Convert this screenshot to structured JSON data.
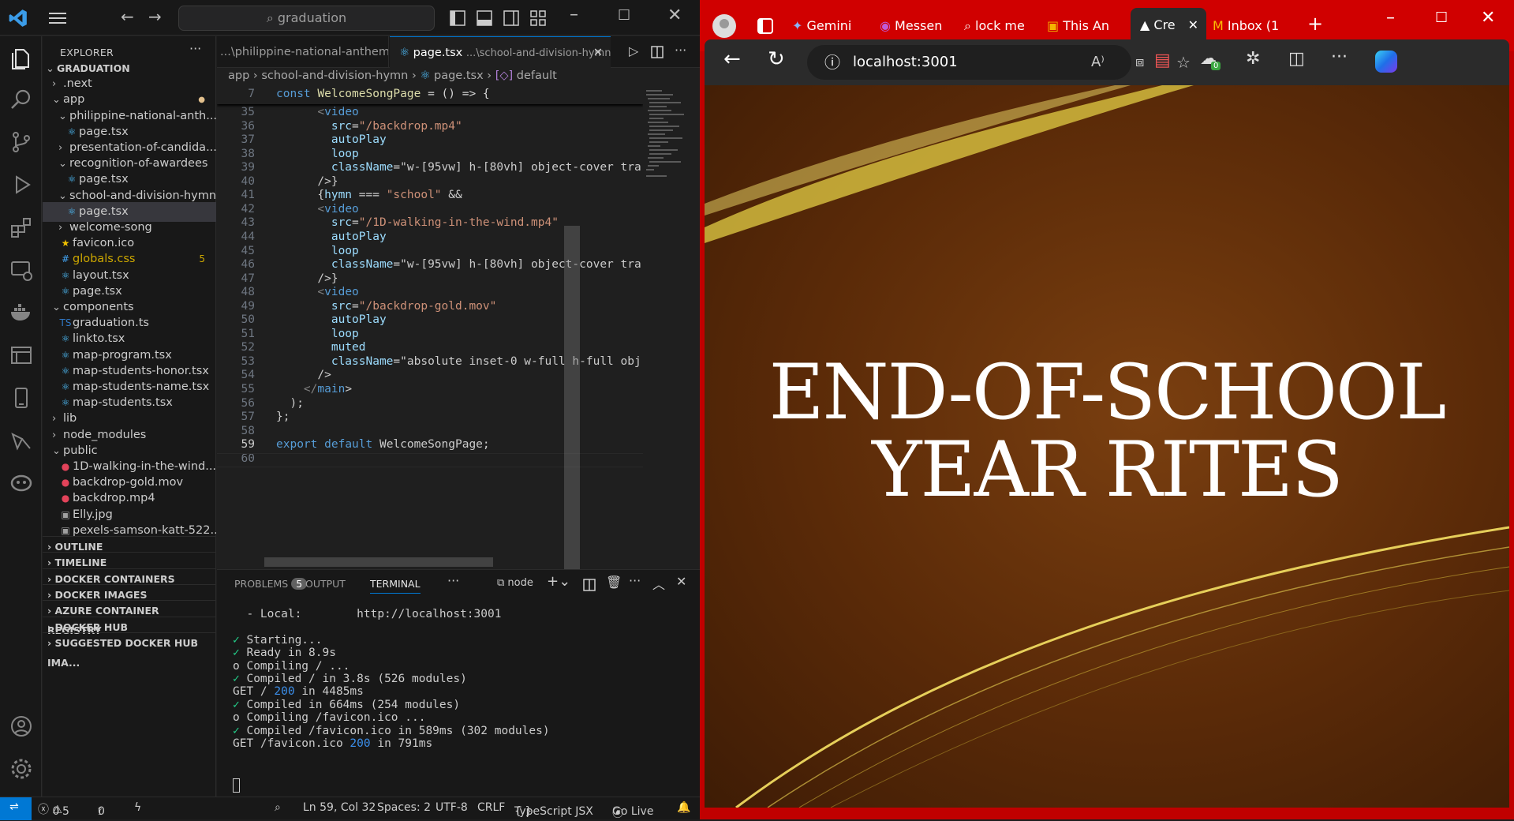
{
  "vscode": {
    "command_center": "graduation",
    "explorer_title": "EXPLORER",
    "tree": [
      {
        "label": "GRADUATION",
        "depth": 0,
        "type": "root"
      },
      {
        "label": ".next",
        "depth": 1,
        "type": "folder-closed"
      },
      {
        "label": "app",
        "depth": 1,
        "type": "folder-open",
        "accent": "#e2c08d"
      },
      {
        "label": "philippine-national-anth...",
        "depth": 2,
        "type": "folder-open"
      },
      {
        "label": "page.tsx",
        "depth": 3,
        "type": "react"
      },
      {
        "label": "presentation-of-candida...",
        "depth": 2,
        "type": "folder-closed"
      },
      {
        "label": "recognition-of-awardees",
        "depth": 2,
        "type": "folder-open"
      },
      {
        "label": "page.tsx",
        "depth": 3,
        "type": "react"
      },
      {
        "label": "school-and-division-hymn",
        "depth": 2,
        "type": "folder-open"
      },
      {
        "label": "page.tsx",
        "depth": 3,
        "type": "react",
        "selected": true
      },
      {
        "label": "welcome-song",
        "depth": 2,
        "type": "folder-closed"
      },
      {
        "label": "favicon.ico",
        "depth": 2,
        "type": "star"
      },
      {
        "label": "globals.css",
        "depth": 2,
        "type": "css",
        "badge": "5",
        "accent": "#cca700"
      },
      {
        "label": "layout.tsx",
        "depth": 2,
        "type": "react"
      },
      {
        "label": "page.tsx",
        "depth": 2,
        "type": "react"
      },
      {
        "label": "components",
        "depth": 1,
        "type": "folder-open"
      },
      {
        "label": "graduation.ts",
        "depth": 2,
        "type": "ts"
      },
      {
        "label": "linkto.tsx",
        "depth": 2,
        "type": "react"
      },
      {
        "label": "map-program.tsx",
        "depth": 2,
        "type": "react"
      },
      {
        "label": "map-students-honor.tsx",
        "depth": 2,
        "type": "react"
      },
      {
        "label": "map-students-name.tsx",
        "depth": 2,
        "type": "react"
      },
      {
        "label": "map-students.tsx",
        "depth": 2,
        "type": "react"
      },
      {
        "label": "lib",
        "depth": 1,
        "type": "folder-closed"
      },
      {
        "label": "node_modules",
        "depth": 1,
        "type": "folder-closed"
      },
      {
        "label": "public",
        "depth": 1,
        "type": "folder-open"
      },
      {
        "label": "1D-walking-in-the-wind....",
        "depth": 2,
        "type": "video"
      },
      {
        "label": "backdrop-gold.mov",
        "depth": 2,
        "type": "video"
      },
      {
        "label": "backdrop.mp4",
        "depth": 2,
        "type": "video"
      },
      {
        "label": "Elly.jpg",
        "depth": 2,
        "type": "image"
      },
      {
        "label": "pexels-samson-katt-522...",
        "depth": 2,
        "type": "image"
      }
    ],
    "sections": [
      "OUTLINE",
      "TIMELINE",
      "DOCKER CONTAINERS",
      "DOCKER IMAGES",
      "AZURE CONTAINER REGISTRY",
      "DOCKER HUB",
      "SUGGESTED DOCKER HUB IMA..."
    ],
    "tabs": [
      {
        "label": "...\\philippine-national-anthem",
        "active": false
      },
      {
        "label": "page.tsx",
        "detail": "...\\school-and-division-hymn",
        "active": true
      }
    ],
    "breadcrumb": [
      "app",
      "school-and-division-hymn",
      "page.tsx",
      "default"
    ],
    "sticky_line": {
      "num": "7",
      "text": "const WelcomeSongPage = () => {"
    },
    "code_lines": [
      {
        "n": "35",
        "t": "      <video"
      },
      {
        "n": "36",
        "t": "        src=\"/backdrop.mp4\""
      },
      {
        "n": "37",
        "t": "        autoPlay"
      },
      {
        "n": "38",
        "t": "        loop"
      },
      {
        "n": "39",
        "t": "        className=\"w-[95vw] h-[80vh] object-cover tra"
      },
      {
        "n": "40",
        "t": "      />}"
      },
      {
        "n": "41",
        "t": "      {hymn === \"school\" &&"
      },
      {
        "n": "42",
        "t": "      <video"
      },
      {
        "n": "43",
        "t": "        src=\"/1D-walking-in-the-wind.mp4\""
      },
      {
        "n": "44",
        "t": "        autoPlay"
      },
      {
        "n": "45",
        "t": "        loop"
      },
      {
        "n": "46",
        "t": "        className=\"w-[95vw] h-[80vh] object-cover tra"
      },
      {
        "n": "47",
        "t": "      />}"
      },
      {
        "n": "48",
        "t": "      <video"
      },
      {
        "n": "49",
        "t": "        src=\"/backdrop-gold.mov\""
      },
      {
        "n": "50",
        "t": "        autoPlay"
      },
      {
        "n": "51",
        "t": "        loop"
      },
      {
        "n": "52",
        "t": "        muted"
      },
      {
        "n": "53",
        "t": "        className=\"absolute inset-0 w-full h-full obj"
      },
      {
        "n": "54",
        "t": "      />"
      },
      {
        "n": "55",
        "t": "    </main>"
      },
      {
        "n": "56",
        "t": "  );"
      },
      {
        "n": "57",
        "t": "};"
      },
      {
        "n": "58",
        "t": ""
      },
      {
        "n": "59",
        "t": "export default WelcomeSongPage;"
      },
      {
        "n": "60",
        "t": ""
      }
    ],
    "panel": {
      "tabs": [
        "PROBLEMS",
        "OUTPUT",
        "TERMINAL"
      ],
      "problems_count": "5",
      "terminal_name": "node",
      "lines": [
        {
          "check": false,
          "t": "  - Local:        http://localhost:3001"
        },
        {
          "check": false,
          "t": ""
        },
        {
          "check": true,
          "t": "Starting..."
        },
        {
          "check": true,
          "t": "Ready in 8.9s"
        },
        {
          "check": false,
          "t": "o Compiling / ..."
        },
        {
          "check": true,
          "t": "Compiled / in 3.8s (526 modules)"
        },
        {
          "check": false,
          "t": "GET / 200 in 4485ms"
        },
        {
          "check": true,
          "t": "Compiled in 664ms (254 modules)"
        },
        {
          "check": false,
          "t": "o Compiling /favicon.ico ..."
        },
        {
          "check": true,
          "t": "Compiled /favicon.ico in 589ms (302 modules)"
        },
        {
          "check": false,
          "t": "GET /favicon.ico 200 in 791ms"
        }
      ]
    },
    "status": {
      "errors": "0",
      "warnings": "5",
      "ports": "0",
      "position": "Ln 59, Col 32",
      "spaces": "Spaces: 2",
      "encoding": "UTF-8",
      "eol": "CRLF",
      "language": "TypeScript JSX",
      "golive": "Go Live"
    }
  },
  "browser": {
    "tabs": [
      "Gemini",
      "Messen",
      "lock me",
      "This An",
      "Cre",
      "Inbox (1"
    ],
    "url": "localhost:3001",
    "extension_badge": "0",
    "page_title_line1": "END-OF-SCHOOL",
    "page_title_line2": "YEAR RITES"
  },
  "colors": {
    "browser_accent": "#d00000",
    "vscode_bg": "#1f1f1f",
    "status_blue": "#0078d4"
  }
}
